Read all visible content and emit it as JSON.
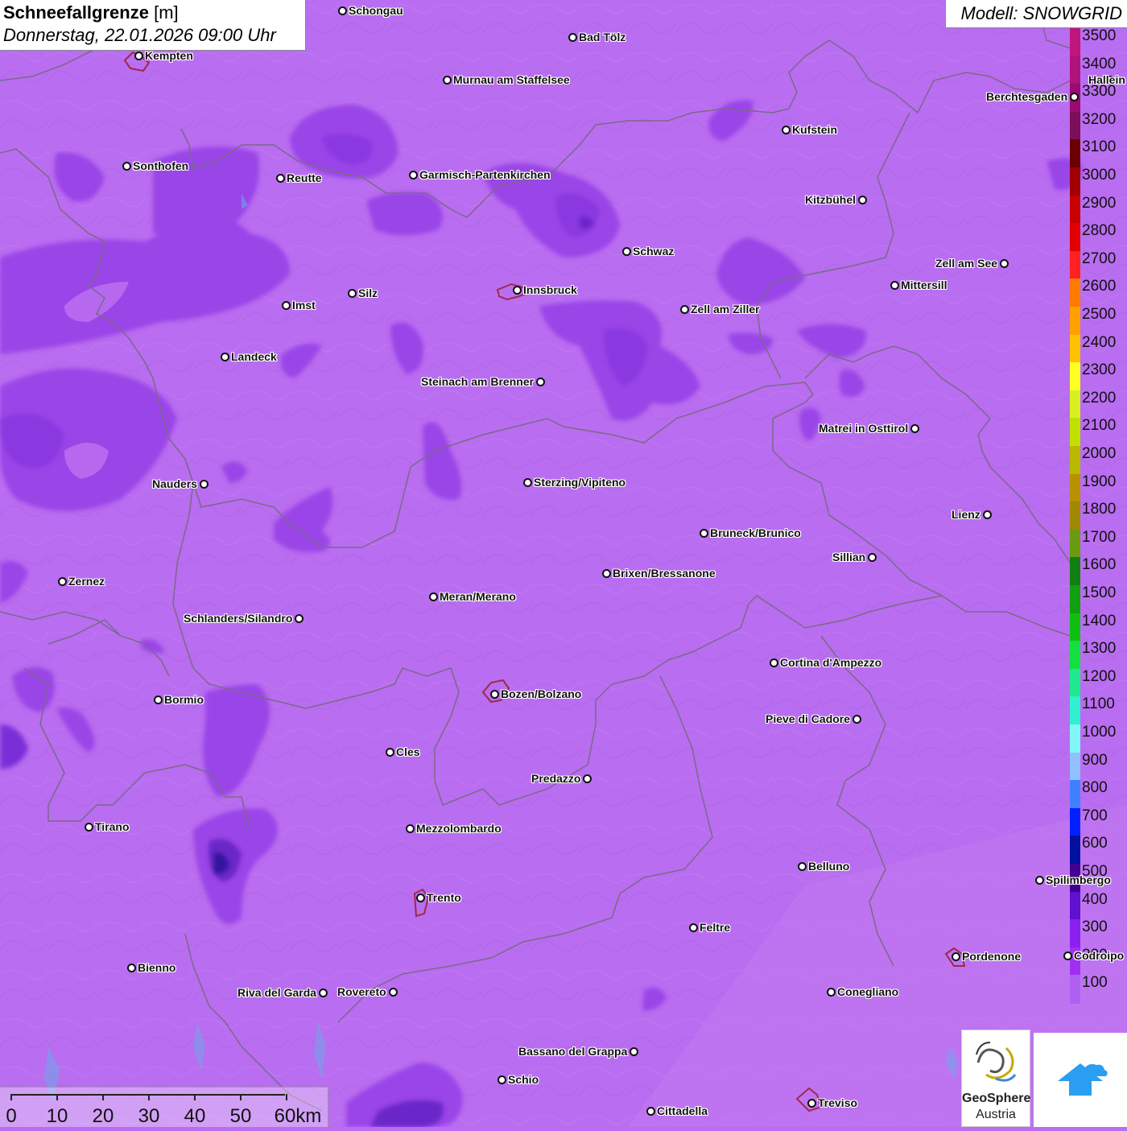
{
  "header": {
    "title_bold": "Schneefallgrenze",
    "title_unit": "[m]",
    "subtitle": "Donnerstag, 22.01.2026 09:00 Uhr",
    "model": "Modell: SNOWGRID"
  },
  "legend": {
    "values": [
      "3500",
      "3400",
      "3300",
      "3200",
      "3100",
      "3000",
      "2900",
      "2800",
      "2700",
      "2600",
      "2500",
      "2400",
      "2300",
      "2200",
      "2100",
      "2000",
      "1900",
      "1800",
      "1700",
      "1600",
      "1500",
      "1400",
      "1300",
      "1200",
      "1100",
      "1000",
      "900",
      "800",
      "700",
      "600",
      "500",
      "400",
      "300",
      "200",
      "100"
    ],
    "colors": [
      "#c0157a",
      "#b0127a",
      "#9a0a70",
      "#7c0f5a",
      "#6a0000",
      "#a00000",
      "#c80000",
      "#e00000",
      "#ff2020",
      "#ff7a00",
      "#ffa000",
      "#ffc000",
      "#ffff20",
      "#d8f020",
      "#c0e000",
      "#b8b800",
      "#b89000",
      "#a08800",
      "#6a9a10",
      "#108010",
      "#10a010",
      "#10c010",
      "#10e040",
      "#20e890",
      "#30f0d0",
      "#80f8f8",
      "#90c0ff",
      "#4080ff",
      "#0020ff",
      "#0010a0",
      "#400090",
      "#6010d0",
      "#8a20f0",
      "#a030f0",
      "#b060f0"
    ]
  },
  "cities": [
    {
      "name": "Schongau",
      "dot": "left"
    },
    {
      "name": "Bad Tölz",
      "dot": "left"
    },
    {
      "name": "Kempten",
      "dot": "left"
    },
    {
      "name": "Murnau am Staffelsee",
      "dot": "left"
    },
    {
      "name": "Hallein",
      "dot": "left"
    },
    {
      "name": "Berchtesgaden",
      "dot": "right"
    },
    {
      "name": "Kufstein",
      "dot": "left"
    },
    {
      "name": "Sonthofen",
      "dot": "left"
    },
    {
      "name": "Reutte",
      "dot": "left"
    },
    {
      "name": "Garmisch-Partenkirchen",
      "dot": "left"
    },
    {
      "name": "Kitzbühel",
      "dot": "right"
    },
    {
      "name": "Schwaz",
      "dot": "left"
    },
    {
      "name": "Zell am See",
      "dot": "right"
    },
    {
      "name": "Innsbruck",
      "dot": "left"
    },
    {
      "name": "Silz",
      "dot": "left"
    },
    {
      "name": "Mittersill",
      "dot": "left"
    },
    {
      "name": "Imst",
      "dot": "left"
    },
    {
      "name": "Zell am Ziller",
      "dot": "left"
    },
    {
      "name": "Landeck",
      "dot": "left"
    },
    {
      "name": "Steinach am Brenner",
      "dot": "right"
    },
    {
      "name": "Matrei in Osttirol",
      "dot": "right"
    },
    {
      "name": "Nauders",
      "dot": "right"
    },
    {
      "name": "Sterzing/Vipiteno",
      "dot": "left"
    },
    {
      "name": "Lienz",
      "dot": "right"
    },
    {
      "name": "Bruneck/Brunico",
      "dot": "left"
    },
    {
      "name": "Sillian",
      "dot": "right"
    },
    {
      "name": "Brixen/Bressanone",
      "dot": "left"
    },
    {
      "name": "Zernez",
      "dot": "left"
    },
    {
      "name": "Meran/Merano",
      "dot": "left"
    },
    {
      "name": "Schlanders/Silandro",
      "dot": "right"
    },
    {
      "name": "Cortina d'Ampezzo",
      "dot": "left"
    },
    {
      "name": "Bozen/Bolzano",
      "dot": "left"
    },
    {
      "name": "Bormio",
      "dot": "left"
    },
    {
      "name": "Pieve di Cadore",
      "dot": "right"
    },
    {
      "name": "Cles",
      "dot": "left"
    },
    {
      "name": "Predazzo",
      "dot": "right"
    },
    {
      "name": "Tirano",
      "dot": "left"
    },
    {
      "name": "Mezzolombardo",
      "dot": "left"
    },
    {
      "name": "Belluno",
      "dot": "left"
    },
    {
      "name": "Spilimbergo",
      "dot": "left"
    },
    {
      "name": "Trento",
      "dot": "left"
    },
    {
      "name": "Feltre",
      "dot": "left"
    },
    {
      "name": "Pordenone",
      "dot": "left"
    },
    {
      "name": "Codroipo",
      "dot": "left"
    },
    {
      "name": "Bienno",
      "dot": "left"
    },
    {
      "name": "Riva del Garda",
      "dot": "right"
    },
    {
      "name": "Rovereto",
      "dot": "right"
    },
    {
      "name": "Conegliano",
      "dot": "left"
    },
    {
      "name": "Bassano del Grappa",
      "dot": "right"
    },
    {
      "name": "Schio",
      "dot": "left"
    },
    {
      "name": "Treviso",
      "dot": "left"
    },
    {
      "name": "Cittadella",
      "dot": "left"
    }
  ],
  "scalebar": {
    "labels": [
      "0",
      "10",
      "20",
      "30",
      "40",
      "50",
      "60km"
    ]
  },
  "logo": {
    "name": "GeoSphere",
    "sub": "Austria"
  },
  "colors": {
    "background": "#b96df0",
    "snowline_low": "#9a45e8",
    "snowline_mid": "#7a2fd8",
    "snowline_deep": "#3018a0"
  }
}
